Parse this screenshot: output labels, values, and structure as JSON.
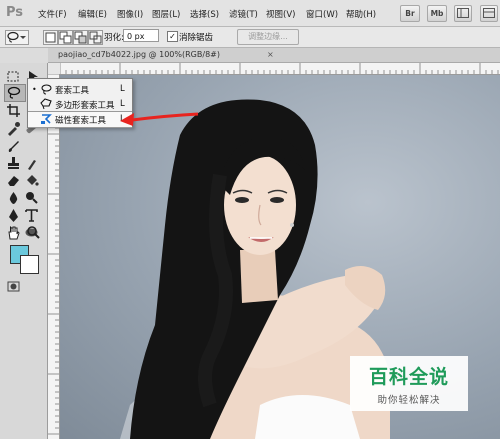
{
  "app": {
    "logo": "Ps"
  },
  "menu": {
    "items": [
      "文件(F)",
      "编辑(E)",
      "图像(I)",
      "图层(L)",
      "选择(S)",
      "滤镜(T)",
      "视图(V)",
      "窗口(W)",
      "帮助(H)"
    ],
    "buttons": [
      "Br",
      "Mb"
    ]
  },
  "options_bar": {
    "feather_label": "羽化:",
    "feather_value": "0 px",
    "antialias_checked": "✓",
    "antialias_label": "消除锯齿",
    "refine_edge_label": "调整边缘..."
  },
  "document_tab": {
    "title": "paojiao_cd7b4022.jpg @ 100%(RGB/8#)",
    "close": "×"
  },
  "flyout": {
    "items": [
      {
        "label": "套索工具",
        "key": "L",
        "active": "•"
      },
      {
        "label": "多边形套索工具",
        "key": "L",
        "active": ""
      },
      {
        "label": "磁性套索工具",
        "key": "L",
        "active": ""
      }
    ]
  },
  "colors": {
    "foreground": "#6bc9dd",
    "background": "#ffffff",
    "arrow": "#e8241f",
    "watermark": "#1f9b5a"
  },
  "watermark": {
    "title": "百科全说",
    "subtitle": "助你轻松解决"
  },
  "icons": [
    "lasso-icon",
    "polygonal-lasso-icon",
    "magnetic-lasso-icon",
    "move-icon",
    "marquee-icon",
    "crop-icon",
    "eyedropper-icon",
    "brush-icon",
    "stamp-icon",
    "eraser-icon",
    "bucket-icon",
    "blur-icon",
    "dodge-icon",
    "pen-icon",
    "type-icon",
    "path-select-icon",
    "shape-icon",
    "hand-icon",
    "zoom-icon"
  ]
}
